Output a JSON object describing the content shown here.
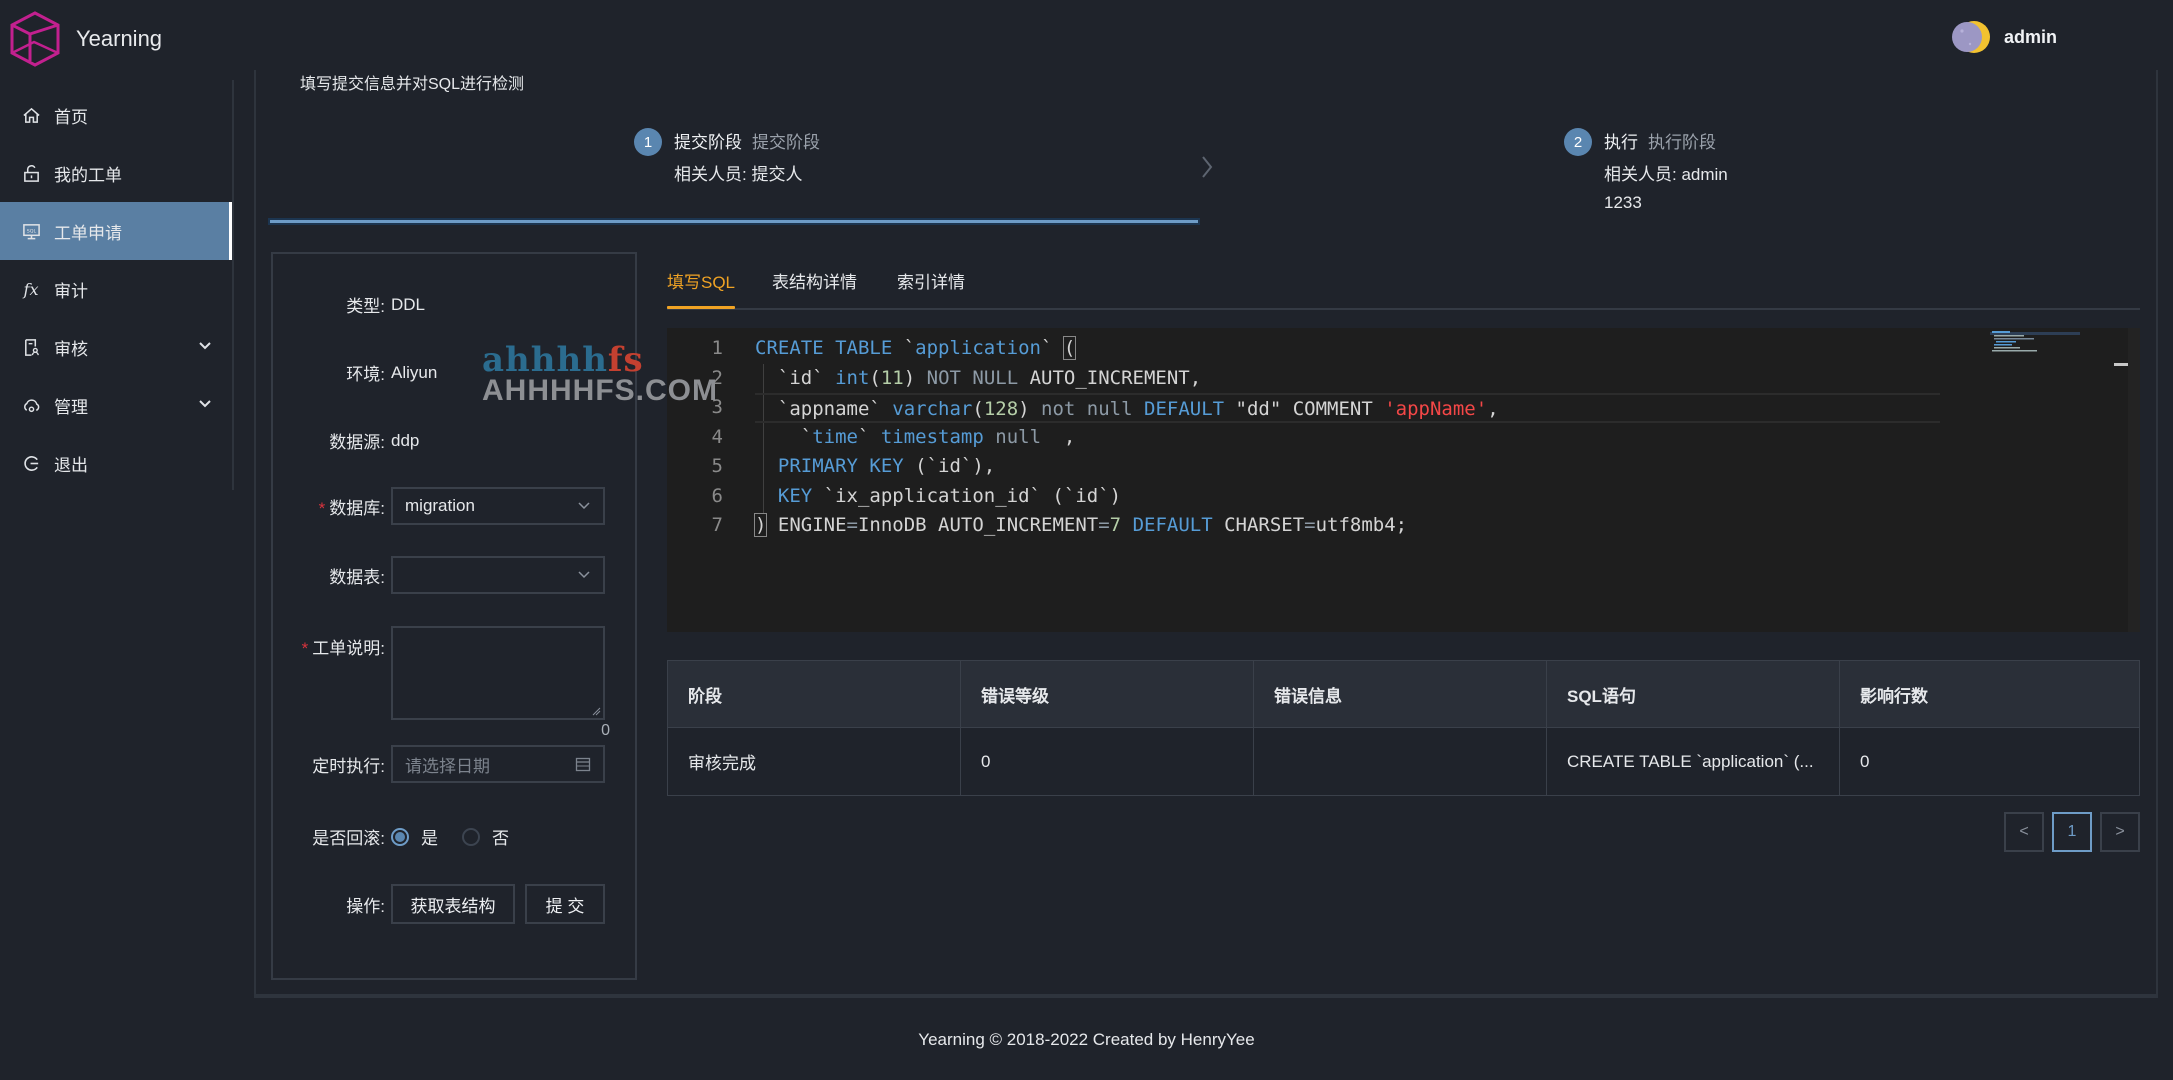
{
  "app": {
    "name": "Yearning",
    "brand_color": "#c2208f"
  },
  "user": {
    "name": "admin",
    "avatar_icon": "moon-avatar-icon"
  },
  "sidebar": {
    "items": [
      {
        "label": "首页",
        "icon": "home-icon"
      },
      {
        "label": "我的工单",
        "icon": "unlock-icon"
      },
      {
        "label": "工单申请",
        "icon": "sql-monitor-icon",
        "active": true
      },
      {
        "label": "审计",
        "icon": "fx-icon"
      },
      {
        "label": "审核",
        "icon": "audit-doc-icon",
        "expandable": true
      },
      {
        "label": "管理",
        "icon": "cloud-manage-icon",
        "expandable": true
      },
      {
        "label": "退出",
        "icon": "logout-icon"
      }
    ],
    "active_color": "#5a7fa3"
  },
  "page": {
    "title": "填写提交信息并对SQL进行检测"
  },
  "steps": [
    {
      "number": "1",
      "title": "提交阶段",
      "subtitle": "提交阶段",
      "desc": [
        "相关人员: 提交人"
      ]
    },
    {
      "number": "2",
      "title": "执行",
      "subtitle": "执行阶段",
      "desc": [
        "相关人员: admin",
        "1233"
      ]
    }
  ],
  "form": {
    "type": {
      "label": "类型:",
      "value": "DDL"
    },
    "env": {
      "label": "环境:",
      "value": "Aliyun"
    },
    "source": {
      "label": "数据源:",
      "value": "ddp"
    },
    "database": {
      "label": "数据库:",
      "value": "migration",
      "required": true
    },
    "table": {
      "label": "数据表:",
      "value": ""
    },
    "description": {
      "label": "工单说明:",
      "value": "",
      "required": true,
      "count": "0"
    },
    "schedule": {
      "label": "定时执行:",
      "placeholder": "请选择日期"
    },
    "rollback": {
      "label": "是否回滚:",
      "options": [
        "是",
        "否"
      ],
      "selected": "是"
    },
    "actions": {
      "label": "操作:",
      "fetch_structure": "获取表结构",
      "submit": "提 交"
    }
  },
  "tabs": [
    {
      "label": "填写SQL",
      "active": true
    },
    {
      "label": "表结构详情"
    },
    {
      "label": "索引详情"
    }
  ],
  "tab_active_color": "#f0a324",
  "editor": {
    "line_numbers": [
      "1",
      "2",
      "3",
      "4",
      "5",
      "6",
      "7"
    ],
    "lines": [
      [
        [
          "kw",
          "CREATE TABLE"
        ],
        [
          "op",
          " `"
        ],
        [
          "kw",
          "application"
        ],
        [
          "op",
          "` "
        ],
        [
          "box",
          "("
        ]
      ],
      [
        [
          "op",
          "  `id` "
        ],
        [
          "kw",
          "int"
        ],
        [
          "op",
          "("
        ],
        [
          "num",
          "11"
        ],
        [
          "op",
          ") "
        ],
        [
          "dim",
          "NOT NULL"
        ],
        [
          "op",
          " AUTO_INCREMENT,"
        ]
      ],
      [
        [
          "op",
          "  `appname` "
        ],
        [
          "kw",
          "varchar"
        ],
        [
          "op",
          "("
        ],
        [
          "num",
          "128"
        ],
        [
          "op",
          ") "
        ],
        [
          "dim",
          "not null"
        ],
        [
          "op",
          " "
        ],
        [
          "kw",
          "DEFAULT"
        ],
        [
          "op",
          " \"dd\" COMMENT "
        ],
        [
          "str",
          "'appName'"
        ],
        [
          "op",
          ","
        ]
      ],
      [
        [
          "op",
          "    `"
        ],
        [
          "kw",
          "time"
        ],
        [
          "op",
          "` "
        ],
        [
          "kw",
          "timestamp"
        ],
        [
          "op",
          " "
        ],
        [
          "dim",
          "null"
        ],
        [
          "op",
          "  ,"
        ]
      ],
      [
        [
          "op",
          "  "
        ],
        [
          "kw",
          "PRIMARY KEY"
        ],
        [
          "op",
          " (`id`),"
        ]
      ],
      [
        [
          "op",
          "  "
        ],
        [
          "kw",
          "KEY"
        ],
        [
          "op",
          " `ix_application_id` (`id`)"
        ]
      ],
      [
        [
          "box",
          ")"
        ],
        [
          "op",
          " ENGINE"
        ],
        [
          "dim",
          "="
        ],
        [
          "op",
          "InnoDB AUTO_INCREMENT"
        ],
        [
          "dim",
          "="
        ],
        [
          "num",
          "7"
        ],
        [
          "op",
          " "
        ],
        [
          "kw",
          "DEFAULT"
        ],
        [
          "op",
          " CHARSET"
        ],
        [
          "dim",
          "="
        ],
        [
          "op",
          "utf8mb4;"
        ]
      ]
    ]
  },
  "results": {
    "columns": [
      "阶段",
      "错误等级",
      "错误信息",
      "SQL语句",
      "影响行数"
    ],
    "rows": [
      [
        "审核完成",
        "0",
        "",
        "CREATE TABLE `application` (...",
        "0"
      ]
    ]
  },
  "pagination": {
    "prev": "<",
    "current": "1",
    "next": ">"
  },
  "footer": {
    "text": "Yearning © 2018-2022 Created by HenryYee"
  },
  "watermark": {
    "logo_text": "ahhhhfs",
    "site": "AHHHHFS.COM"
  }
}
